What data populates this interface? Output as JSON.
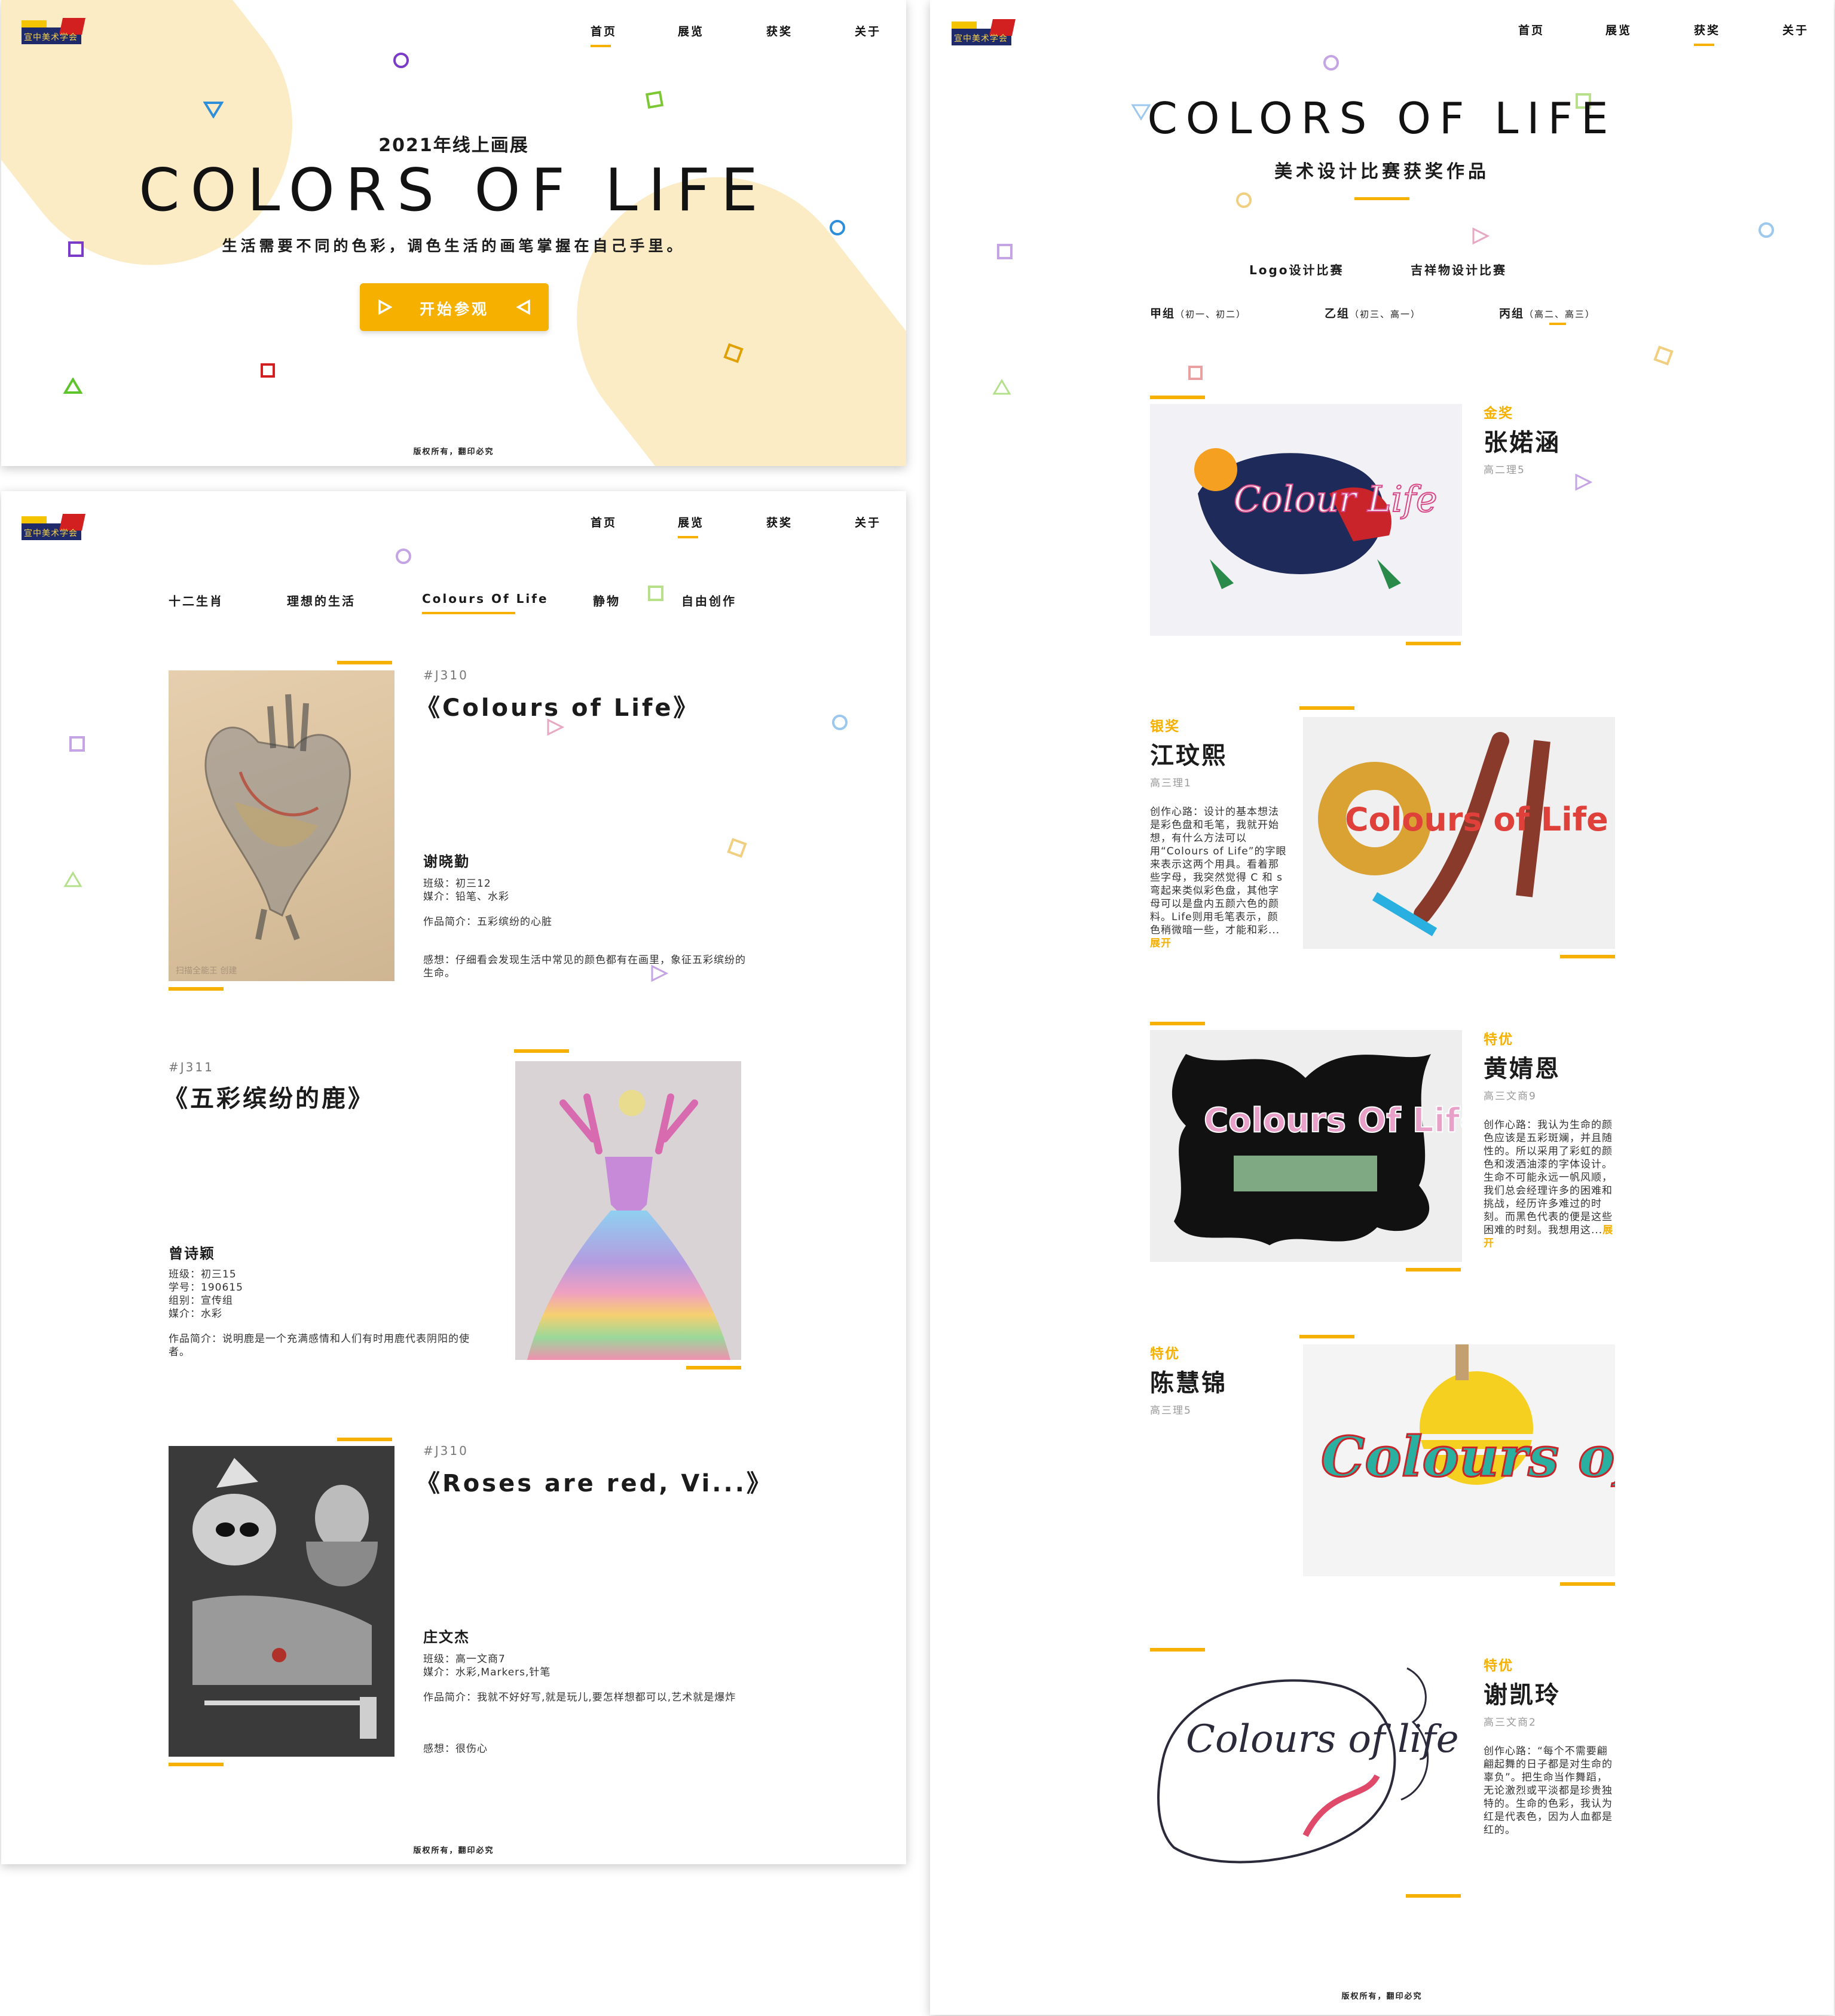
{
  "logo": {
    "text": "宣中美术学会"
  },
  "nav": {
    "home": "首页",
    "exhibition": "展览",
    "awards": "获奖",
    "about": "关于"
  },
  "footer": "版权所有，翻印必究",
  "hero": {
    "subtitle": "2021年线上画展",
    "title": "COLORS OF LIFE",
    "description": "生活需要不同的色彩，调色生活的画笔掌握在自己手里。",
    "button_label": "开始参观"
  },
  "exhibition": {
    "categories": [
      "十二生肖",
      "理想的生活",
      "Colours Of Life",
      "静物",
      "自由创作"
    ],
    "artworks": [
      {
        "code": "#J310",
        "title": "《Colours of Life》",
        "artist": "谢晓勤",
        "class": "班级：初三12",
        "medium": "媒介：铅笔、水彩",
        "intro": "作品简介：五彩缤纷的心脏",
        "thoughts": "感想：仔细看会发现生活中常见的颜色都有在画里，象征五彩缤纷的生命。",
        "watermark": "扫描全能王 创建"
      },
      {
        "code": "#J311",
        "title": "《五彩缤纷的鹿》",
        "artist": "曾诗颖",
        "class": "班级：初三15",
        "student_id": "学号：190615",
        "group": "组别：宣传组",
        "medium": "媒介：水彩",
        "intro": "作品简介：说明鹿是一个充满感情和人们有时用鹿代表阴阳的使者。"
      },
      {
        "code": "#J310",
        "title": "《Roses are red, Vi...》",
        "artist": "庄文杰",
        "class": "班级：高一文商7",
        "medium": "媒介：水彩,Markers,针笔",
        "intro": "作品简介：我就不好好写,就是玩儿,要怎样想都可以,艺术就是爆炸",
        "thoughts": "感想：很伤心"
      }
    ]
  },
  "awards_page": {
    "title": "COLORS OF LIFE",
    "subtitle": "美术设计比赛获奖作品",
    "competitions": [
      "Logo设计比赛",
      "吉祥物设计比赛"
    ],
    "groups": [
      {
        "name": "甲组",
        "grades": "（初一、初二）"
      },
      {
        "name": "乙组",
        "grades": "（初三、高一）"
      },
      {
        "name": "丙组",
        "grades": "（高二、高三）"
      }
    ],
    "more_label": "展开",
    "winners": [
      {
        "award": "金奖",
        "name": "张婼涵",
        "class": "高二理5",
        "text": ""
      },
      {
        "award": "银奖",
        "name": "江玟熙",
        "class": "高三理1",
        "text": "创作心路：设计的基本想法是彩色盘和毛笔，我就开始想，有什么方法可以用“Colours of Life”的字眼来表示这两个用具。看着那些字母，我突然觉得 C 和 s 弯起来类似彩色盘，其他字母可以是盘内五颜六色的颜料。Life则用毛笔表示，颜色稍微暗一些，才能和彩..."
      },
      {
        "award": "特优",
        "name": "黄婧恩",
        "class": "高三文商9",
        "text": "创作心路：我认为生命的颜色应该是五彩斑斓，并且随性的。所以采用了彩虹的颜色和泼洒油漆的字体设计。生命不可能永远一帆风顺，我们总会经理许多的困难和挑战，经历许多难过的时刻。而黑色代表的便是这些困难的时刻。我想用这..."
      },
      {
        "award": "特优",
        "name": "陈慧锦",
        "class": "高三理5",
        "text": ""
      },
      {
        "award": "特优",
        "name": "谢凯玲",
        "class": "高三文商2",
        "text": "创作心路：“每个不需要翩翩起舞的日子都是对生命的辜负”。把生命当作舞蹈，无论激烈或平淡都是珍贵独特的。生命的色彩，我认为红是代表色，因为人血都是红的。"
      }
    ],
    "logo_texts": [
      "Colour Life",
      "Colours of Life",
      "Colours Of Life",
      "Colours of life",
      "Colours of life"
    ]
  },
  "colors": {
    "accent": "#f5b000",
    "blob": "#fcecc6",
    "text": "#1b1b1b"
  }
}
